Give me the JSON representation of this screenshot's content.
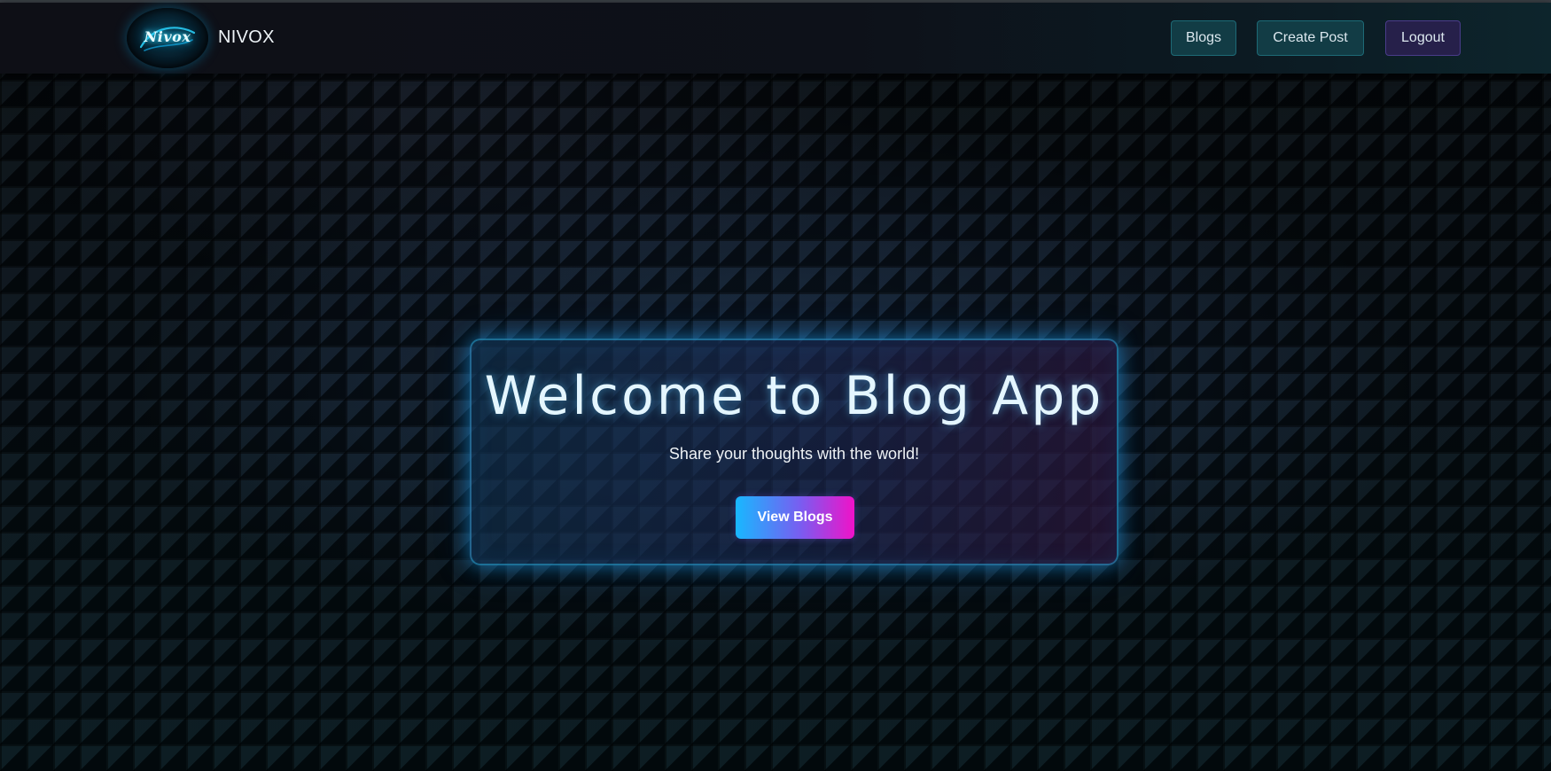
{
  "navbar": {
    "logo_text": "Nivox",
    "brand": "NIVOX",
    "links": [
      {
        "label": "Blogs"
      },
      {
        "label": "Create Post"
      },
      {
        "label": "Logout"
      }
    ]
  },
  "hero": {
    "title": "Welcome to Blog App",
    "subtitle": "Share your thoughts with the world!",
    "cta_label": "View Blogs"
  },
  "colors": {
    "accent_cyan": "#18b8ff",
    "accent_magenta": "#f012c8",
    "nav_button_teal": "#123c45",
    "nav_button_purple": "#26204a",
    "background": "#02080c"
  },
  "icons": {
    "logo": "nivox-logo"
  }
}
